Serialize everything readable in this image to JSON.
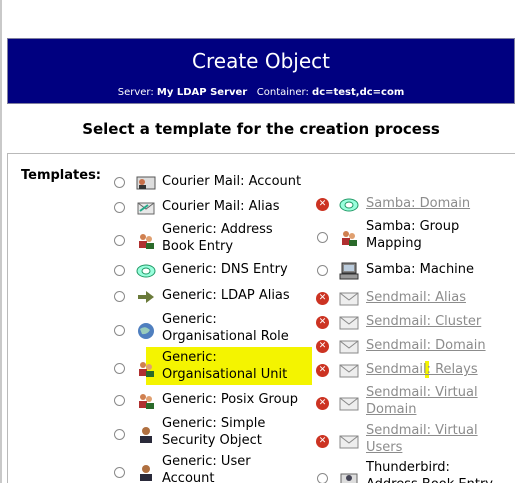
{
  "header": {
    "title": "Create Object",
    "server_label": "Server:",
    "server_value": "My LDAP Server",
    "container_label": "Container:",
    "container_value": "dc=test,dc=com"
  },
  "heading": "Select a template for the creation process",
  "templates_label": "Templates:",
  "left_items": [
    {
      "lines": [
        "Courier Mail: Account"
      ],
      "icon": "mail-account-icon",
      "enabled": true
    },
    {
      "lines": [
        "Courier Mail: Alias"
      ],
      "icon": "mail-alias-icon",
      "enabled": true
    },
    {
      "lines": [
        "Generic: Address",
        "Book Entry"
      ],
      "icon": "address-book-icon",
      "enabled": true
    },
    {
      "lines": [
        "Generic: DNS Entry"
      ],
      "icon": "dns-icon",
      "enabled": true
    },
    {
      "lines": [
        "Generic: LDAP Alias"
      ],
      "icon": "arrow-alias-icon",
      "enabled": true
    },
    {
      "lines": [
        "Generic:",
        "Organisational Role"
      ],
      "icon": "globe-icon",
      "enabled": true
    },
    {
      "lines": [
        "Generic:",
        "Organisational Unit"
      ],
      "icon": "group-icon",
      "enabled": true
    },
    {
      "lines": [
        "Generic: Posix Group"
      ],
      "icon": "group-icon",
      "enabled": true
    },
    {
      "lines": [
        "Generic: Simple",
        "Security Object"
      ],
      "icon": "user-icon",
      "enabled": true
    },
    {
      "lines": [
        "Generic: User",
        "Account"
      ],
      "icon": "user-icon",
      "enabled": true
    }
  ],
  "right_items": [
    {
      "lines": [
        "Samba: Domain"
      ],
      "icon": "dns-icon",
      "enabled": false
    },
    {
      "lines": [
        "Samba: Group",
        "Mapping"
      ],
      "icon": "group-icon",
      "enabled": true
    },
    {
      "lines": [
        "Samba: Machine"
      ],
      "icon": "computer-icon",
      "enabled": true
    },
    {
      "lines": [
        "Sendmail: Alias"
      ],
      "icon": "envelope-icon",
      "enabled": false
    },
    {
      "lines": [
        "Sendmail: Cluster"
      ],
      "icon": "envelope-icon",
      "enabled": false
    },
    {
      "lines": [
        "Sendmail: Domain"
      ],
      "icon": "envelope-icon",
      "enabled": false
    },
    {
      "lines": [
        "Sendmail: Relays"
      ],
      "icon": "envelope-icon",
      "enabled": false
    },
    {
      "lines": [
        "Sendmail: Virtual",
        "Domain"
      ],
      "icon": "envelope-icon",
      "enabled": false
    },
    {
      "lines": [
        "Sendmail: Virtual",
        "Users"
      ],
      "icon": "envelope-icon",
      "enabled": false
    },
    {
      "lines": [
        "Thunderbird:",
        "Address Book Entry"
      ],
      "icon": "thunderbird-icon",
      "enabled": true
    }
  ],
  "colors": {
    "header_bg": "#000080",
    "highlight": "#f4f400",
    "disabled": "#8c8c8c",
    "error_icon": "#cc3322"
  }
}
